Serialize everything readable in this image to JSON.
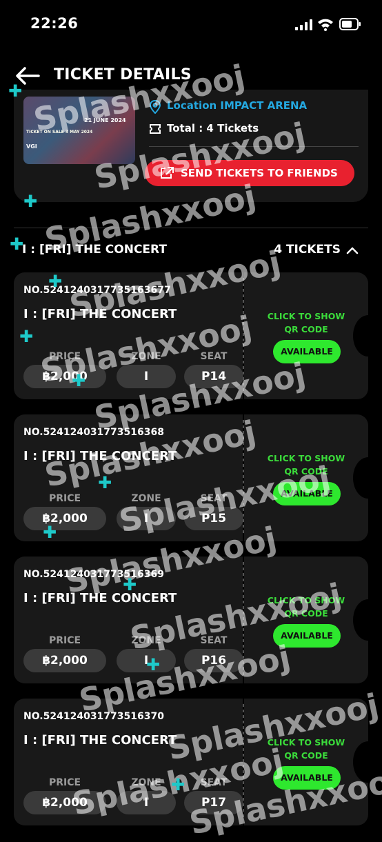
{
  "status": {
    "time": "22:26"
  },
  "header": {
    "title": "TICKET DETAILS"
  },
  "event": {
    "poster": {
      "date": "21 JUNE 2024",
      "sale": "TICKET ON SALE 3 MAY 2024",
      "logos": "VGI"
    },
    "location": "Location IMPACT ARENA",
    "total": "Total : 4 Tickets",
    "send_label": "SEND TICKETS TO FRIENDS"
  },
  "group": {
    "name": "I : [FRI] THE CONCERT",
    "count": "4 TICKETS"
  },
  "labels": {
    "price": "PRICE",
    "zone": "ZONE",
    "seat": "SEAT",
    "qr_line1": "CLICK TO SHOW",
    "qr_line2": "QR CODE",
    "available": "AVAILABLE"
  },
  "tickets": [
    {
      "no": "NO.5241240317735163677",
      "name": "I : [FRI] THE CONCERT",
      "price": "฿2,000",
      "zone": "I",
      "seat": "P14"
    },
    {
      "no": "NO.524124031773516368",
      "name": "I : [FRI] THE CONCERT",
      "price": "฿2,000",
      "zone": "I",
      "seat": "P15"
    },
    {
      "no": "NO.524124031773516369",
      "name": "I : [FRI] THE CONCERT",
      "price": "฿2,000",
      "zone": "I",
      "seat": "P16"
    },
    {
      "no": "NO.524124031773516370",
      "name": "I : [FRI] THE CONCERT",
      "price": "฿2,000",
      "zone": "I",
      "seat": "P17"
    }
  ],
  "watermark": "Splashxxooj",
  "colors": {
    "accent_green": "#2ee82e",
    "send_red": "#e8212f",
    "location_blue": "#24a8e0"
  }
}
